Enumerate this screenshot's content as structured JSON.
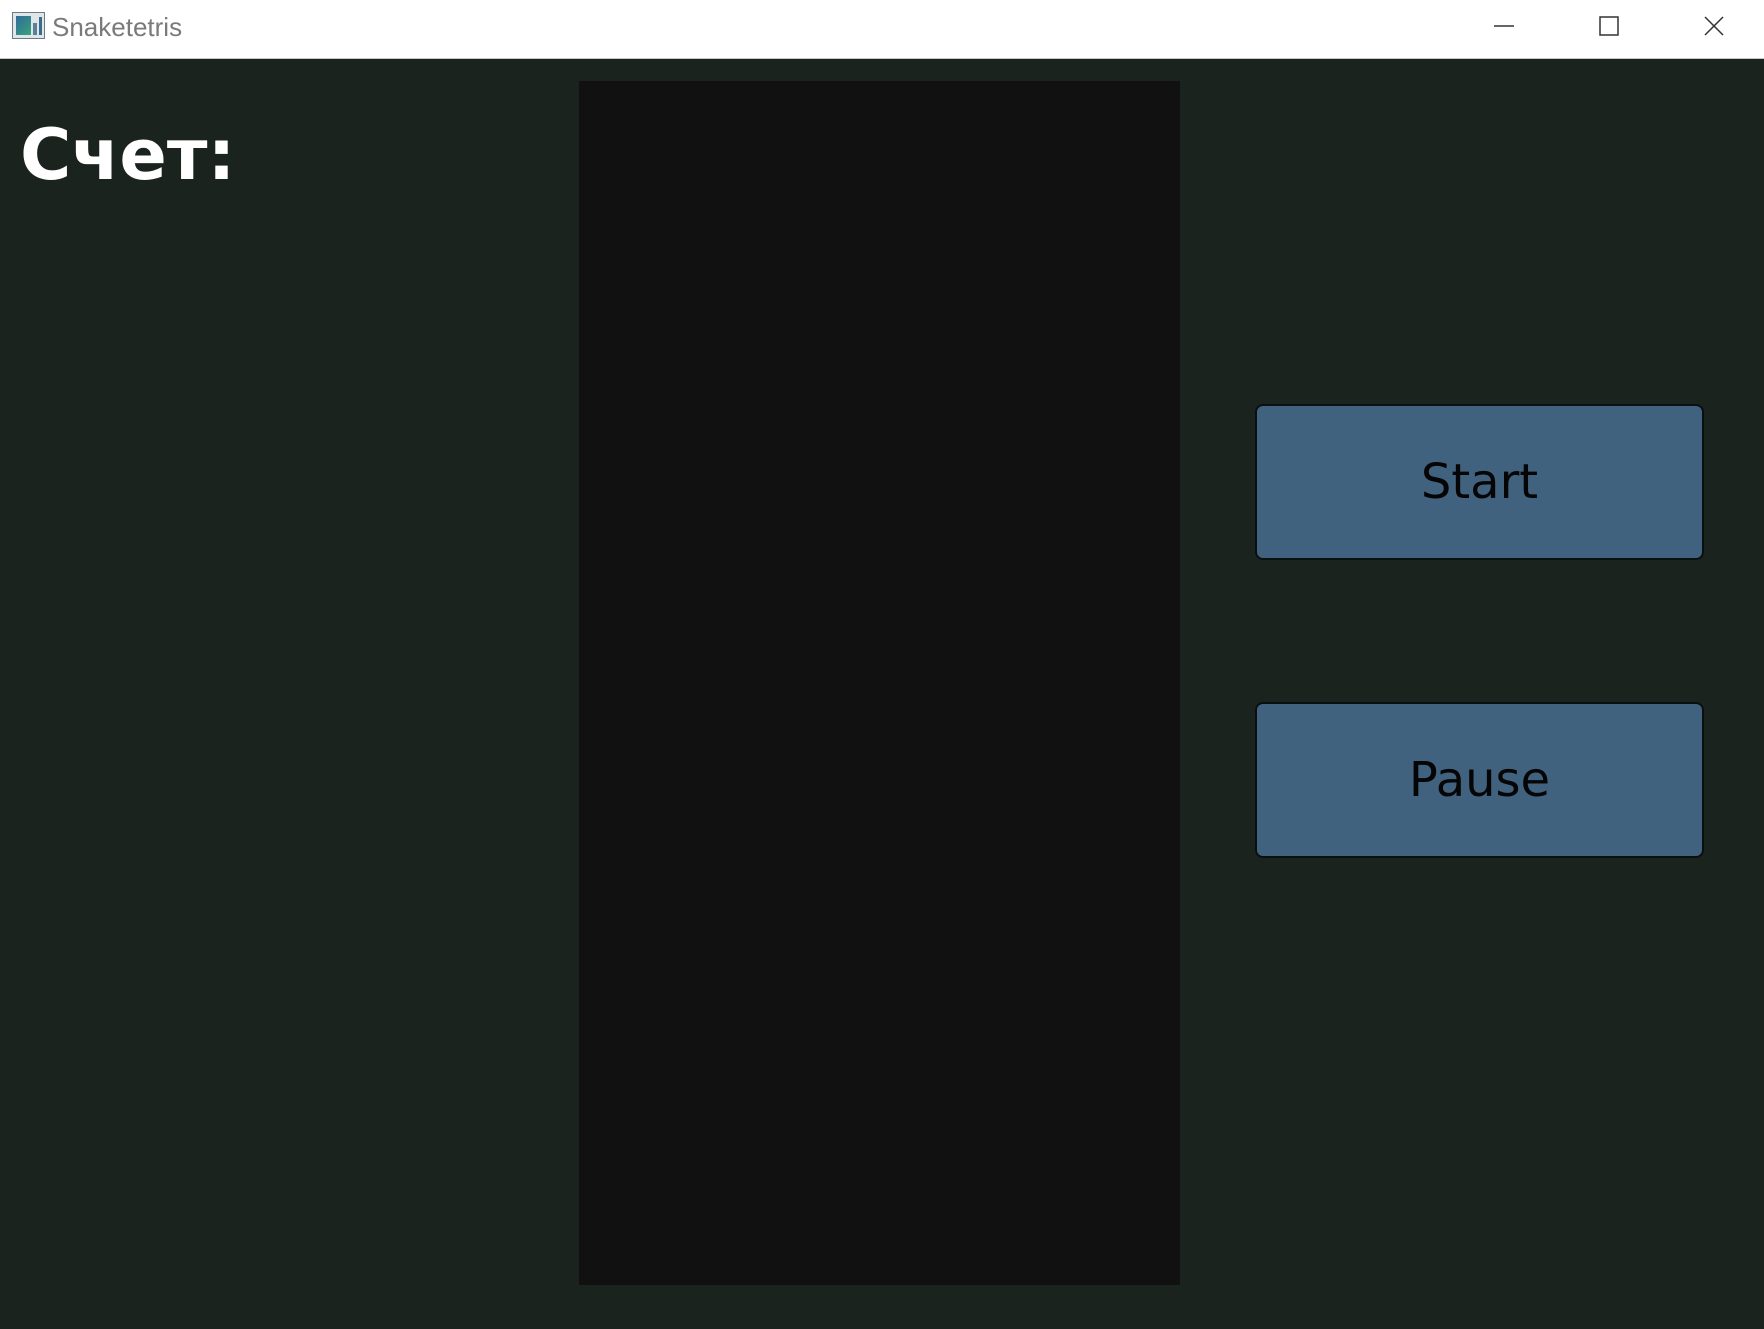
{
  "window": {
    "title": "Snaketetris",
    "controls": {
      "minimize_icon": "minimize-icon",
      "maximize_icon": "maximize-icon",
      "close_icon": "close-icon"
    }
  },
  "game": {
    "score_label": "Счет:",
    "board_color": "#111111",
    "background_color": "#1b231e"
  },
  "buttons": {
    "start_label": "Start",
    "pause_label": "Pause",
    "color": "#41627f"
  }
}
